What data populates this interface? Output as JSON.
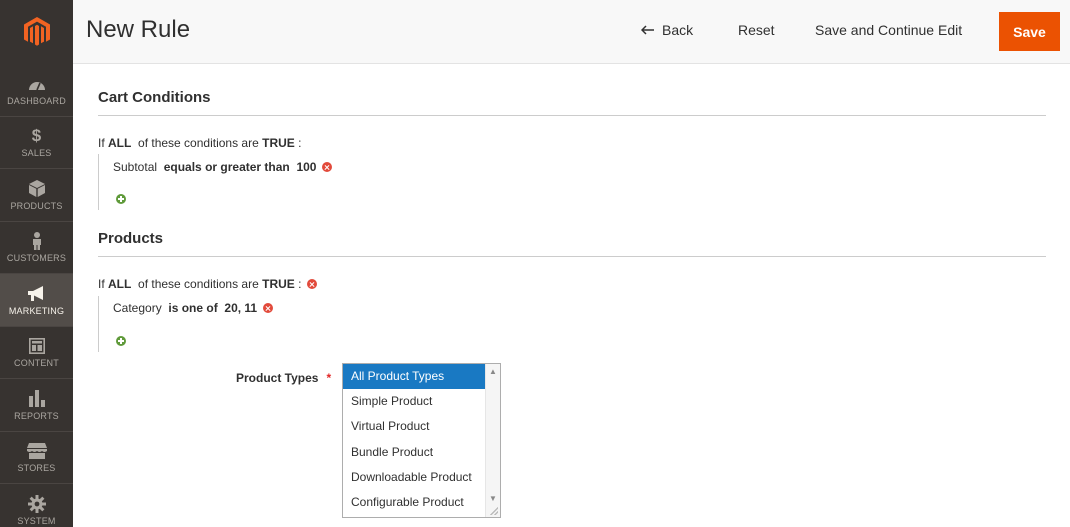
{
  "colors": {
    "sidebar_bg": "#373330",
    "accent": "#eb5202",
    "selected": "#1979c3"
  },
  "sidebar": {
    "items": [
      {
        "label": "DASHBOARD",
        "icon": "dashboard-icon"
      },
      {
        "label": "SALES",
        "icon": "dollar-icon"
      },
      {
        "label": "PRODUCTS",
        "icon": "cube-icon"
      },
      {
        "label": "CUSTOMERS",
        "icon": "person-icon"
      },
      {
        "label": "MARKETING",
        "icon": "megaphone-icon"
      },
      {
        "label": "CONTENT",
        "icon": "layout-icon"
      },
      {
        "label": "REPORTS",
        "icon": "bar-chart-icon"
      },
      {
        "label": "STORES",
        "icon": "store-icon"
      },
      {
        "label": "SYSTEM",
        "icon": "gear-icon"
      }
    ]
  },
  "header": {
    "title": "New Rule",
    "back_label": "Back",
    "reset_label": "Reset",
    "save_continue_label": "Save and Continue Edit",
    "save_label": "Save"
  },
  "cart_conditions": {
    "title": "Cart Conditions",
    "if_text": "If",
    "aggregator": "ALL",
    "middle_text": "of these conditions are",
    "value": "TRUE",
    "colon": ":",
    "condition": {
      "attribute": "Subtotal",
      "operator": "equals or greater than",
      "value": "100"
    }
  },
  "products": {
    "title": "Products",
    "if_text": "If",
    "aggregator": "ALL",
    "middle_text": "of these conditions are",
    "value": "TRUE",
    "colon": ":",
    "condition": {
      "attribute": "Category",
      "operator": "is one of",
      "value": "20, 11"
    }
  },
  "product_types": {
    "label": "Product Types",
    "required_mark": "*",
    "options": [
      "All Product Types",
      "Simple Product",
      "Virtual Product",
      "Bundle Product",
      "Downloadable Product",
      "Configurable Product"
    ],
    "selected": "All Product Types"
  }
}
